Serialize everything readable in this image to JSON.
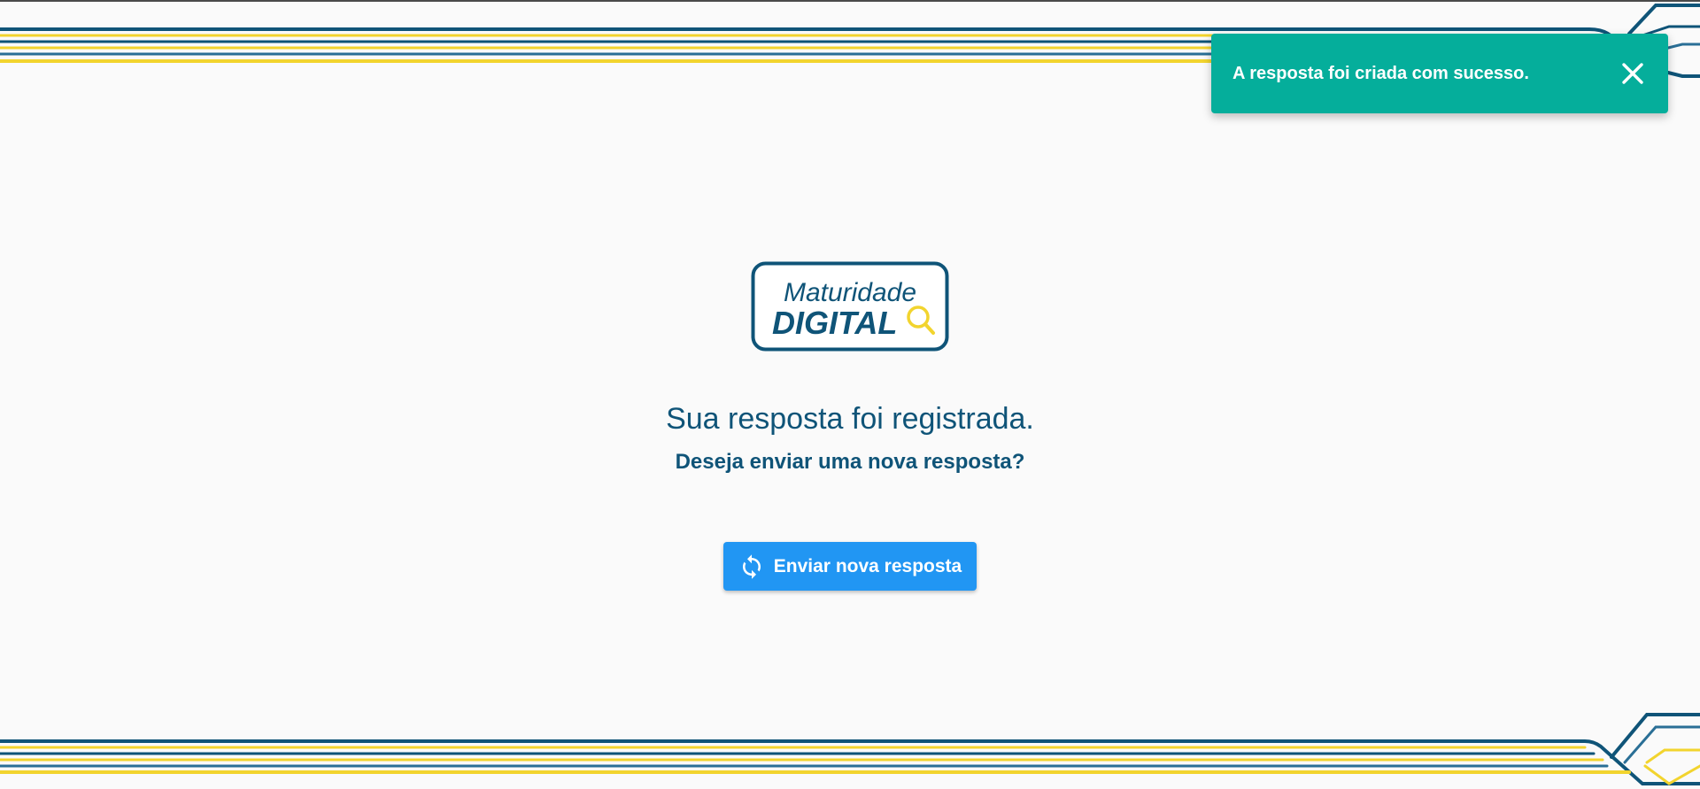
{
  "toast": {
    "message": "A resposta foi criada com sucesso.",
    "close_icon": "close-icon",
    "background_color": "#05ae9b"
  },
  "logo": {
    "line1": "Maturidade",
    "line2": "DIGITAL",
    "icon": "magnifier-icon",
    "brand_color": "#0f5478",
    "accent_color": "#f2d42e"
  },
  "main": {
    "title": "Sua resposta foi registrada.",
    "subtitle": "Deseja enviar uma nova resposta?",
    "button_label": "Enviar nova resposta",
    "button_icon": "refresh-icon",
    "button_color": "#2196f3"
  },
  "decoration": {
    "primary_color": "#0f5478",
    "secondary_color": "#f2d42e"
  }
}
